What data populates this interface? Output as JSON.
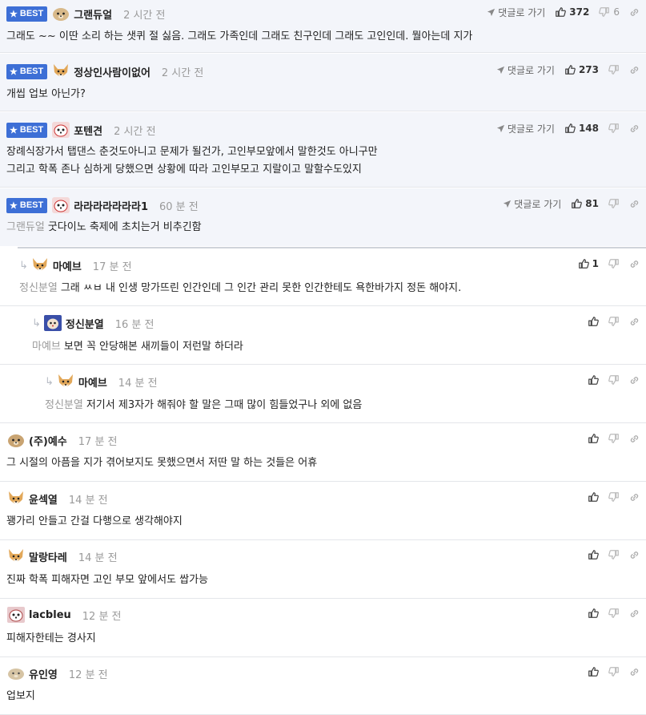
{
  "labels": {
    "best": "BEST",
    "goto_comment": "댓글로 가기"
  },
  "comments": [
    {
      "nick": "그랜듀얼",
      "time": "2 시간 전",
      "mention": "",
      "text": "그래도 ~~ 이딴 소리 하는 샛퀴 절 싫음. 그래도 가족인데 그래도 친구인데 그래도 고인인데. 뭘아는데 지가",
      "up": "372",
      "down": "6",
      "best": true
    },
    {
      "nick": "정상인사람이없어",
      "time": "2 시간 전",
      "mention": "",
      "text": "개씹 업보 아닌가?",
      "up": "273",
      "down": "",
      "best": true
    },
    {
      "nick": "포텐견",
      "time": "2 시간 전",
      "mention": "",
      "text": "장례식장가서 탭댄스 춘것도아니고 문제가 될건가, 고인부모앞에서 말한것도 아니구만",
      "text2": "그리고 학폭 존나 심하게 당했으면 상황에 따라 고인부모고 지랄이고 말할수도있지",
      "up": "148",
      "down": "",
      "best": true
    },
    {
      "nick": "라라라라라라라1",
      "time": "60 분 전",
      "mention": "그랜듀얼",
      "text": "굿다이노 축제에 초치는거 비추긴함",
      "up": "81",
      "down": "",
      "best": true
    },
    {
      "nick": "마예브",
      "time": "17 분 전",
      "mention": "정신분열",
      "text": "그래 ㅆㅂ 내 인생 망가뜨린 인간인데 그 인간 관리 못한 인간한테도 욕한바가지 정돈 해야지.",
      "up": "1",
      "down": ""
    },
    {
      "nick": "정신분열",
      "time": "16 분 전",
      "mention": "마예브",
      "text": "보면 꼭 안당해본 새끼들이 저런말 하더라",
      "up": "",
      "down": ""
    },
    {
      "nick": "마예브",
      "time": "14 분 전",
      "mention": "정신분열",
      "text": "저기서 제3자가 해줘야 할 말은 그때 많이 힘들었구나 외에 없음",
      "up": "",
      "down": ""
    },
    {
      "nick": "(주)예수",
      "time": "17 분 전",
      "mention": "",
      "text": "그 시절의 아픔을 지가 겪어보지도 못했으면서 저딴 말 하는 것들은 어휴",
      "up": "",
      "down": ""
    },
    {
      "nick": "윤섹열",
      "time": "14 분 전",
      "mention": "",
      "text": "꽹가리 안들고 간걸 다행으로 생각해야지",
      "up": "",
      "down": ""
    },
    {
      "nick": "말랑타레",
      "time": "14 분 전",
      "mention": "",
      "text": "진짜 학폭 피해자면 고인 부모 앞에서도 쌉가능",
      "up": "",
      "down": ""
    },
    {
      "nick": "lacbleu",
      "time": "12 분 전",
      "mention": "",
      "text": "피해자한테는 경사지",
      "up": "",
      "down": ""
    },
    {
      "nick": "유인영",
      "time": "12 분 전",
      "mention": "",
      "text": "업보지",
      "up": "",
      "down": ""
    }
  ]
}
